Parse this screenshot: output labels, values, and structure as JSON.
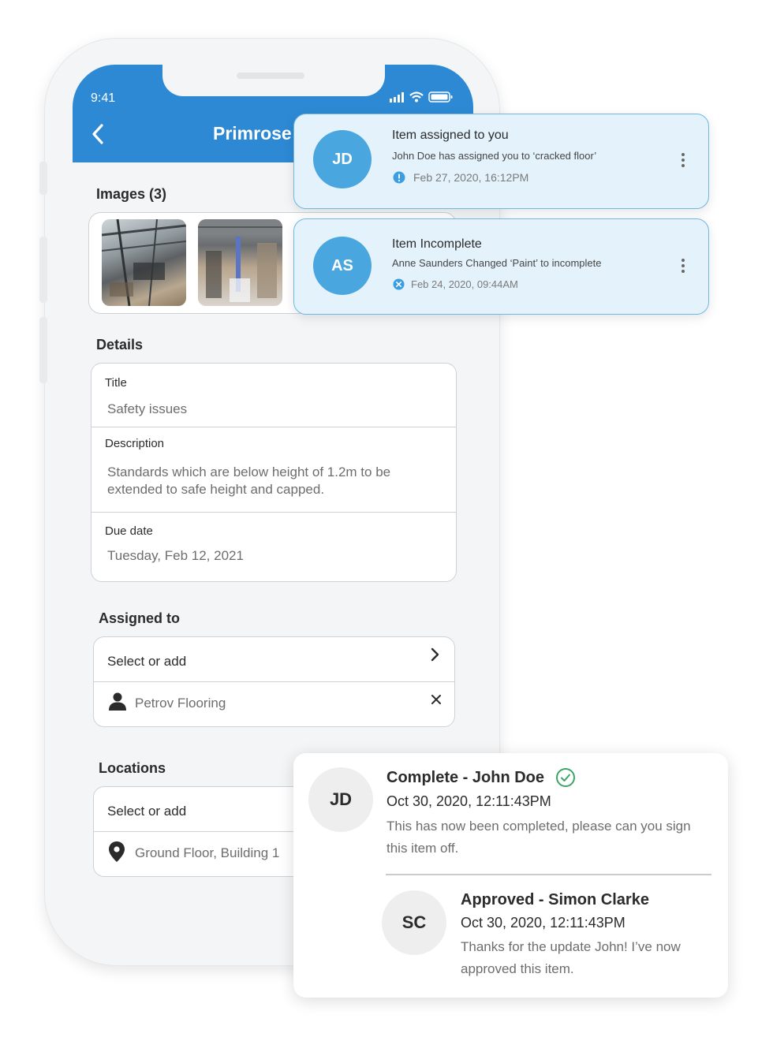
{
  "status_bar": {
    "time": "9:41"
  },
  "header": {
    "title": "Primrose"
  },
  "images": {
    "title": "Images (3)"
  },
  "details": {
    "title": "Details",
    "fields": [
      {
        "label": "Title",
        "value": "Safety issues"
      },
      {
        "label": "Description",
        "value": "Standards which are below height of 1.2m to be extended to safe height and capped."
      },
      {
        "label": "Due date",
        "value": "Tuesday, Feb 12, 2021"
      }
    ]
  },
  "assigned": {
    "title": "Assigned to",
    "select_label": "Select or add",
    "entry": "Petrov Flooring"
  },
  "locations": {
    "title": "Locations",
    "select_label": "Select or add",
    "entry": "Ground Floor, Building 1"
  },
  "notifications": [
    {
      "initials": "JD",
      "title": "Item assigned to you",
      "body": "John Doe has assigned you to ‘cracked floor’",
      "date": "Feb 27, 2020, 16:12PM",
      "status_icon": "info-icon"
    },
    {
      "initials": "AS",
      "title": "Item Incomplete",
      "body": "Anne Saunders Changed ‘Paint’ to incomplete",
      "date": "Feb 24, 2020, 09:44AM",
      "status_icon": "close-circle-icon"
    }
  ],
  "comments": [
    {
      "initials": "JD",
      "title": "Complete - John Doe",
      "date": "Oct 30, 2020, 12:11:43PM",
      "body": "This has now been completed, please can you sign this item off.",
      "status_icon": "check-circle-icon"
    },
    {
      "initials": "SC",
      "title": "Approved - Simon Clarke",
      "date": "Oct 30, 2020, 12:11:43PM",
      "body": "Thanks for the update John! I’ve now approved this item."
    }
  ],
  "colors": {
    "brand_blue": "#2d89d3",
    "notification_bg": "#e3f2fb",
    "notification_border": "#6fb8e3",
    "avatar_blue": "#4aa6de",
    "complete_green": "#3aa564"
  }
}
